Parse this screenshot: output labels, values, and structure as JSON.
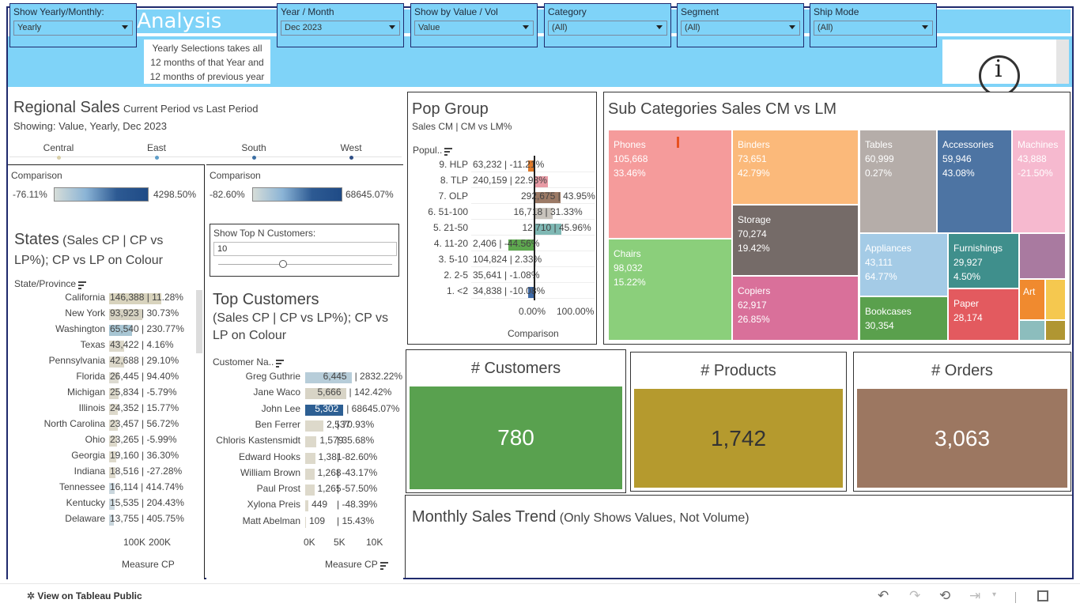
{
  "title": "Retail Sales Analysis",
  "filters": [
    {
      "label": "Show Yearly/Monthly:",
      "value": "Yearly"
    },
    {
      "label": "Year / Month",
      "value": "Dec 2023"
    },
    {
      "label": "Show by Value / Vol",
      "value": "Value"
    },
    {
      "label": "Category",
      "value": "(All)"
    },
    {
      "label": "Segment",
      "value": "(All)"
    },
    {
      "label": "Ship Mode",
      "value": "(All)"
    }
  ],
  "note": {
    "line1": "Yearly Selections takes all",
    "line2": "12 months of that Year and",
    "line3": "12 months of previous year"
  },
  "info_icon": "i",
  "regional": {
    "title": "Regional Sales",
    "title_suffix": "Current Period vs Last Period",
    "showing_label": "Showing:",
    "showing_value": "Value, Yearly, Dec 2023",
    "regions": [
      "Central",
      "East",
      "South",
      "West"
    ],
    "region_colors": [
      "#d9cfa8",
      "#5f9ec9",
      "#3c6fa4",
      "#2f4f86"
    ]
  },
  "comparison_left": {
    "label": "Comparison",
    "min": "-76.11%",
    "max": "4298.50%"
  },
  "comparison_right": {
    "label": "Comparison",
    "min": "-82.60%",
    "max": "68645.07%"
  },
  "states": {
    "title": "States",
    "title_suffix": "(Sales CP | CP vs LP%); CP vs LP on Colour",
    "col_header": "State/Province",
    "rows": [
      {
        "name": "California",
        "value": "146,388",
        "pct": "11.28%",
        "v": 146388,
        "color": "#d8d3bd"
      },
      {
        "name": "New York",
        "value": "93,923",
        "pct": "30.73%",
        "v": 93923,
        "color": "#d6d2c2"
      },
      {
        "name": "Washington",
        "value": "65,540",
        "pct": "230.77%",
        "v": 65540,
        "color": "#a8c6d4"
      },
      {
        "name": "Texas",
        "value": "43,422",
        "pct": "4.16%",
        "v": 43422,
        "color": "#ddd9cb"
      },
      {
        "name": "Pennsylvania",
        "value": "42,688",
        "pct": "29.10%",
        "v": 42688,
        "color": "#ddd9cb"
      },
      {
        "name": "Florida",
        "value": "26,445",
        "pct": "94.40%",
        "v": 26445,
        "color": "#dcdad0"
      },
      {
        "name": "Michigan",
        "value": "25,834",
        "pct": "-5.79%",
        "v": 25834,
        "color": "#ddd9cb"
      },
      {
        "name": "Illinois",
        "value": "24,352",
        "pct": "15.77%",
        "v": 24352,
        "color": "#ddd9cb"
      },
      {
        "name": "North Carolina",
        "value": "23,457",
        "pct": "56.72%",
        "v": 23457,
        "color": "#ddd9cb"
      },
      {
        "name": "Ohio",
        "value": "23,265",
        "pct": "-5.99%",
        "v": 23265,
        "color": "#ddd9cb"
      },
      {
        "name": "Georgia",
        "value": "19,160",
        "pct": "36.30%",
        "v": 19160,
        "color": "#ddd9cb"
      },
      {
        "name": "Indiana",
        "value": "18,516",
        "pct": "-27.28%",
        "v": 18516,
        "color": "#ddd9cb"
      },
      {
        "name": "Tennessee",
        "value": "16,114",
        "pct": "414.74%",
        "v": 16114,
        "color": "#c9d6dd"
      },
      {
        "name": "Kentucky",
        "value": "15,535",
        "pct": "204.43%",
        "v": 15535,
        "color": "#ccd8de"
      },
      {
        "name": "Delaware",
        "value": "13,755",
        "pct": "405.75%",
        "v": 13755,
        "color": "#c9d6dd"
      }
    ],
    "axis_ticks": [
      "100K",
      "200K"
    ],
    "axis_label": "Measure CP"
  },
  "topn": {
    "label": "Show Top N Customers:",
    "value": "10"
  },
  "customers": {
    "title": "Top Customers",
    "subtitle": "(Sales CP | CP vs LP%); CP vs LP on Colour",
    "col_header": "Customer Na..",
    "rows": [
      {
        "name": "Greg Guthrie",
        "value": "6,445",
        "pct": "2832.22%",
        "v": 6445,
        "color": "#b7cdd9"
      },
      {
        "name": "Jane Waco",
        "value": "5,666",
        "pct": "142.42%",
        "v": 5666,
        "color": "#d8d4c6"
      },
      {
        "name": "John Lee",
        "value": "5,302",
        "pct": "68645.07%",
        "v": 5302,
        "color": "#2d5f93"
      },
      {
        "name": "Ben Ferrer",
        "value": "2,537",
        "pct": "70.93%",
        "v": 2537,
        "color": "#ddd9cb"
      },
      {
        "name": "Chloris Kastensmidt",
        "value": "1,579",
        "pct": "35.68%",
        "v": 1579,
        "color": "#ddd9cb"
      },
      {
        "name": "Edward Hooks",
        "value": "1,381",
        "pct": "-82.60%",
        "v": 1381,
        "color": "#ddd9cb"
      },
      {
        "name": "William Brown",
        "value": "1,268",
        "pct": "-43.17%",
        "v": 1268,
        "color": "#ddd9cb"
      },
      {
        "name": "Paul Prost",
        "value": "1,265",
        "pct": "-57.50%",
        "v": 1265,
        "color": "#ddd9cb"
      },
      {
        "name": "Xylona Preis",
        "value": "449",
        "pct": "-48.39%",
        "v": 449,
        "color": "#ddd9cb"
      },
      {
        "name": "Matt Abelman",
        "value": "109",
        "pct": "15.43%",
        "v": 109,
        "color": "#ddd9cb"
      }
    ],
    "axis_ticks": [
      "0K",
      "5K",
      "10K"
    ],
    "axis_label": "Measure CP"
  },
  "pop": {
    "title": "Pop Group",
    "subtitle": "Sales CM | CM vs LM%",
    "col_header": "Popul..",
    "rows": [
      {
        "name": "9. HLP",
        "value": "63,232",
        "pct": "-11.21%",
        "pv": -11.21,
        "color": "#e07b2a"
      },
      {
        "name": "8. TLP",
        "value": "240,159",
        "pct": "22.98%",
        "pv": 22.98,
        "color": "#e89aa5"
      },
      {
        "name": "7. OLP",
        "value": "292,675",
        "pct": "43.95%",
        "pv": 43.95,
        "color": "#9c7a66"
      },
      {
        "name": "6. 51-100",
        "value": "16,718",
        "pct": "31.33%",
        "pv": 31.33,
        "color": "#c8c3bc"
      },
      {
        "name": "5. 21-50",
        "value": "12,710",
        "pct": "45.96%",
        "pv": 45.96,
        "color": "#7fb8b4"
      },
      {
        "name": "4. 11-20",
        "value": "2,406",
        "pct": "-44.56%",
        "pv": -44.56,
        "color": "#5ea84f"
      },
      {
        "name": "3. 5-10",
        "value": "104,824",
        "pct": "2.33%",
        "pv": 2.33,
        "color": "#e6e6e6"
      },
      {
        "name": "2. 2-5",
        "value": "35,641",
        "pct": "-1.08%",
        "pv": -1.08,
        "color": "#e6e6e6"
      },
      {
        "name": "1. <2",
        "value": "34,838",
        "pct": "-10.08%",
        "pv": -10.08,
        "color": "#3e6aa8"
      }
    ],
    "axis_ticks": [
      "0.00%",
      "100.00%"
    ],
    "axis_label": "Comparison"
  },
  "subcat": {
    "title": "Sub Categories Sales CM vs LM",
    "items": [
      {
        "name": "Phones",
        "value": "105,668",
        "pct": "33.46%",
        "color": "#f59b9b"
      },
      {
        "name": "Chairs",
        "value": "98,032",
        "pct": "15.22%",
        "color": "#8bcf7b"
      },
      {
        "name": "Binders",
        "value": "73,651",
        "pct": "42.79%",
        "color": "#fbb97a"
      },
      {
        "name": "Storage",
        "value": "70,274",
        "pct": "19.42%",
        "color": "#756b68"
      },
      {
        "name": "Copiers",
        "value": "62,917",
        "pct": "26.85%",
        "color": "#d9709a"
      },
      {
        "name": "Tables",
        "value": "60,999",
        "pct": "0.27%",
        "color": "#b5ada9"
      },
      {
        "name": "Accessories",
        "value": "59,946",
        "pct": "43.08%",
        "color": "#4d74a3"
      },
      {
        "name": "Machines",
        "value": "43,888",
        "pct": "-21.50%",
        "color": "#f6b9cf"
      },
      {
        "name": "Appliances",
        "value": "43,111",
        "pct": "64.77%",
        "color": "#a4cbe6"
      },
      {
        "name": "Furnishings",
        "value": "29,927",
        "pct": "4.50%",
        "color": "#3f8f8c"
      },
      {
        "name": "Bookcases",
        "value": "30,354",
        "pct": "",
        "color": "#5aa04d"
      },
      {
        "name": "Paper",
        "value": "28,174",
        "pct": "",
        "color": "#e35a5f"
      },
      {
        "name": "Art",
        "value": "",
        "pct": "",
        "color": "#f08a2f"
      }
    ],
    "extra_colors": [
      "#a97aa0",
      "#f5c84f",
      "#8cbdbd",
      "#b09632"
    ]
  },
  "kpis": [
    {
      "title": "# Customers",
      "value": "780",
      "color": "#59a14f",
      "text_color": "#ffffff"
    },
    {
      "title": "# Products",
      "value": "1,742",
      "color": "#b59a2e",
      "text_color": "#333333"
    },
    {
      "title": "# Orders",
      "value": "3,063",
      "color": "#9c7761",
      "text_color": "#ffffff"
    }
  ],
  "trend": {
    "title": "Monthly Sales Trend",
    "suffix": "(Only Shows Values, Not Volume)"
  },
  "footer": {
    "link": "View on Tableau Public"
  }
}
